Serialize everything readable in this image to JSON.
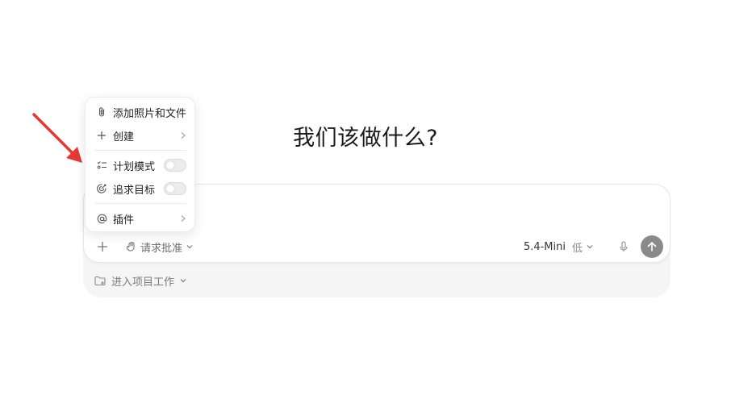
{
  "title": "我们该做什么?",
  "menu": {
    "items": [
      {
        "label": "添加照片和文件",
        "icon": "paperclip-icon"
      },
      {
        "label": "创建",
        "icon": "plus-icon",
        "submenu": true
      },
      {
        "label": "计划模式",
        "icon": "checklist-icon",
        "toggle": false
      },
      {
        "label": "追求目标",
        "icon": "target-icon",
        "toggle": false
      },
      {
        "label": "插件",
        "icon": "at-icon",
        "submenu": true
      }
    ]
  },
  "composer": {
    "approval_label": "请求批准",
    "model_name": "5.4-Mini",
    "model_level": "低"
  },
  "project": {
    "label": "进入项目工作"
  },
  "colors": {
    "annotation_arrow": "#e53935",
    "send_button": "#8a8a8a"
  }
}
